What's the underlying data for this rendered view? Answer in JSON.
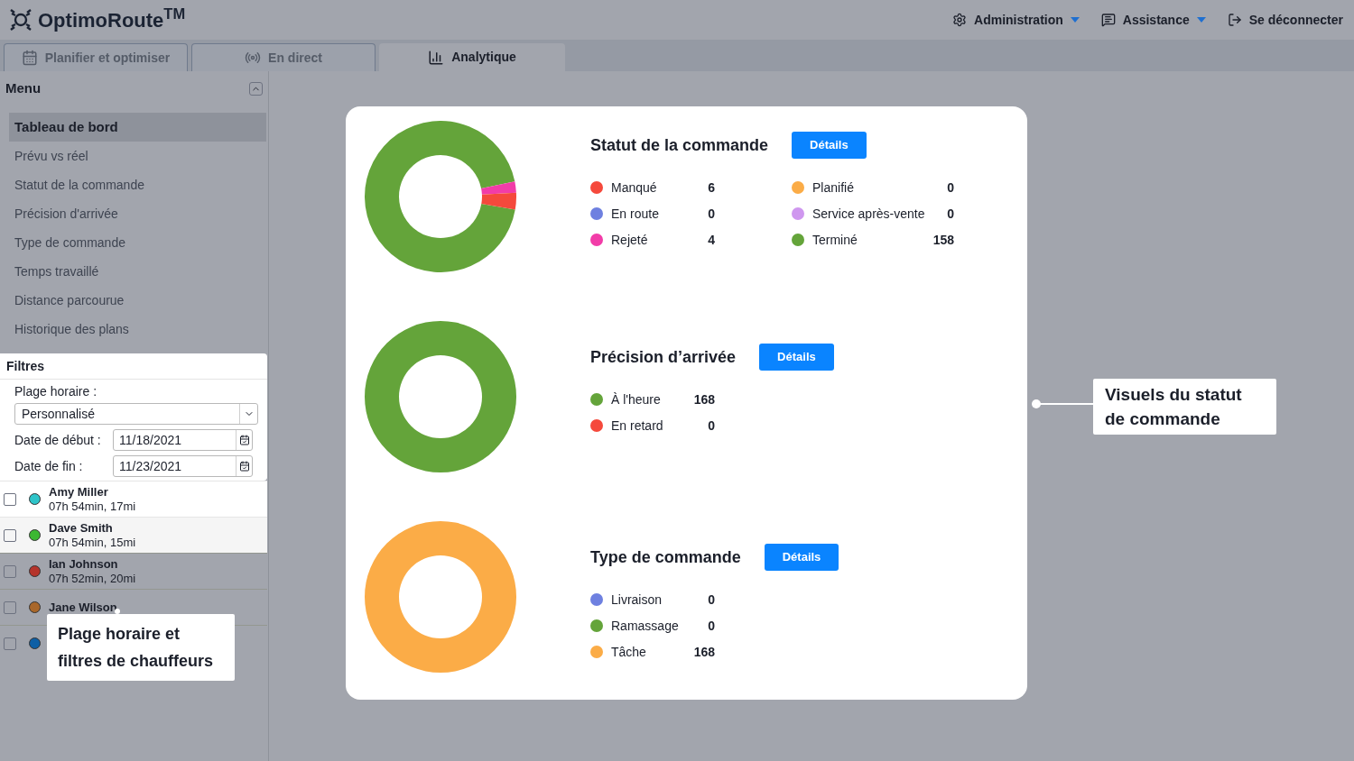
{
  "header": {
    "logo": "OptimoRoute$^{TM}$",
    "menu": [
      {
        "kind": "settings",
        "label": "Administration",
        "dropdown": true
      },
      {
        "kind": "chat",
        "label": "Assistance",
        "dropdown": true
      },
      {
        "kind": "logout",
        "label": "Se déconnecter",
        "dropdown": false
      }
    ]
  },
  "tabs": [
    {
      "kind": "calendar",
      "label": "Planifier et optimiser",
      "selected": false
    },
    {
      "kind": "live",
      "label": "En direct",
      "selected": false
    },
    {
      "kind": "bars",
      "label": "Analytique",
      "selected": true
    }
  ],
  "sidebar": {
    "title": "Menu",
    "items": [
      {
        "label": "Tableau de bord",
        "selected": true
      },
      {
        "label": "Prévu vs réel",
        "selected": false
      },
      {
        "label": "Statut de la commande",
        "selected": false
      },
      {
        "label": "Précision d'arrivée",
        "selected": false
      },
      {
        "label": "Type de commande",
        "selected": false
      },
      {
        "label": "Temps travaillé",
        "selected": false
      },
      {
        "label": "Distance parcourue",
        "selected": false
      },
      {
        "label": "Historique des plans",
        "selected": false
      }
    ]
  },
  "filters": {
    "title": "Filtres",
    "range_label": "Plage horaire :",
    "range_value": "Personnalisé",
    "start_label": "Date de début :",
    "start_value": "11/18/2021",
    "end_label": "Date de fin :",
    "end_value": "11/23/2021",
    "drivers": [
      {
        "name": "Amy Miller",
        "detail": "07h 54min, 17mi",
        "color": "#2ec4c9",
        "checked": false,
        "highlighted": true
      },
      {
        "name": "Dave Smith",
        "detail": "07h 54min, 15mi",
        "color": "#3cb832",
        "checked": false,
        "highlighted": true
      },
      {
        "name": "Ian Johnson",
        "detail": "07h 52min, 20mi",
        "color": "#b5342b",
        "checked": false,
        "highlighted": false
      },
      {
        "name": "Jane Wilson",
        "color": "#a9672a",
        "checked": false,
        "highlighted": false
      },
      {
        "color": "#0d5fa5",
        "checked": false,
        "highlighted": false
      }
    ]
  },
  "sections": [
    {
      "title": "Statut de la commande",
      "button": "Détails",
      "legend": [
        {
          "label": "Manqué",
          "value": "6",
          "color": "#f5493c"
        },
        {
          "label": "En route",
          "value": "0",
          "color": "#6e80e0"
        },
        {
          "label": "Rejeté",
          "value": "4",
          "color": "#f23ca8"
        },
        {
          "label": "Planifié",
          "value": "0",
          "color": "#fbac47"
        },
        {
          "label": "Service après-vente",
          "value": "0",
          "color": "#cf97ef"
        },
        {
          "label": "Terminé",
          "value": "158",
          "color": "#64a43a"
        }
      ]
    },
    {
      "title": "Précision d’arrivée",
      "button": "Détails",
      "legend": [
        {
          "label": "À l'heure",
          "value": "168",
          "color": "#64a43a"
        },
        {
          "label": "En retard",
          "value": "0",
          "color": "#f5493c"
        }
      ]
    },
    {
      "title": "Type de commande",
      "button": "Détails",
      "legend": [
        {
          "label": "Livraison",
          "value": "0",
          "color": "#6e80e0"
        },
        {
          "label": "Ramassage",
          "value": "0",
          "color": "#64a43a"
        },
        {
          "label": "Tâche",
          "value": "168",
          "color": "#fbac47"
        }
      ]
    }
  ],
  "callouts": [
    {
      "text": "Plage horaire et filtres de chauffeurs"
    },
    {
      "text": "Visuels du statut de commande"
    }
  ]
}
